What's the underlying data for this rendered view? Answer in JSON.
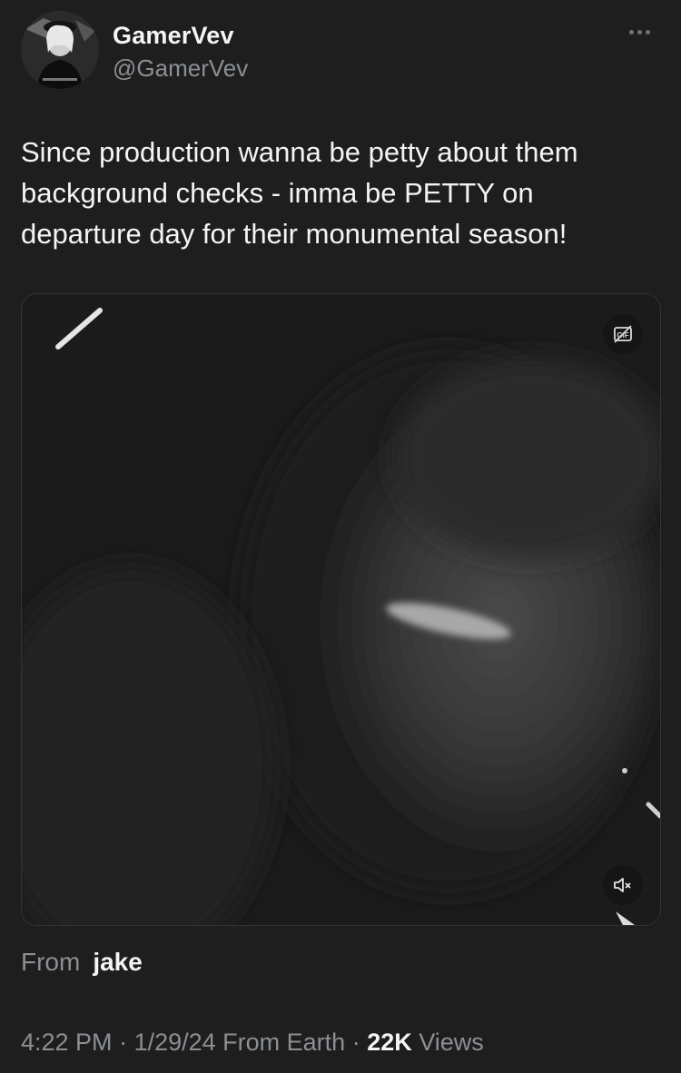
{
  "author": {
    "display_name": "GamerVev",
    "handle": "@GamerVev"
  },
  "tweet": {
    "text": "Since production wanna be petty about them background checks - imma be PETTY on departure day for their monumental season!"
  },
  "media": {
    "gif_icon": "gif-toggle-icon",
    "mute_icon": "mute-icon"
  },
  "attribution": {
    "from_label": "From",
    "from_name": "jake"
  },
  "meta": {
    "time": "4:22 PM",
    "sep1": " · ",
    "date": "1/29/24",
    "source": " From Earth",
    "sep2": " · ",
    "views_count": "22K",
    "views_label": " Views"
  },
  "icons": {
    "more": "more-options-icon"
  }
}
